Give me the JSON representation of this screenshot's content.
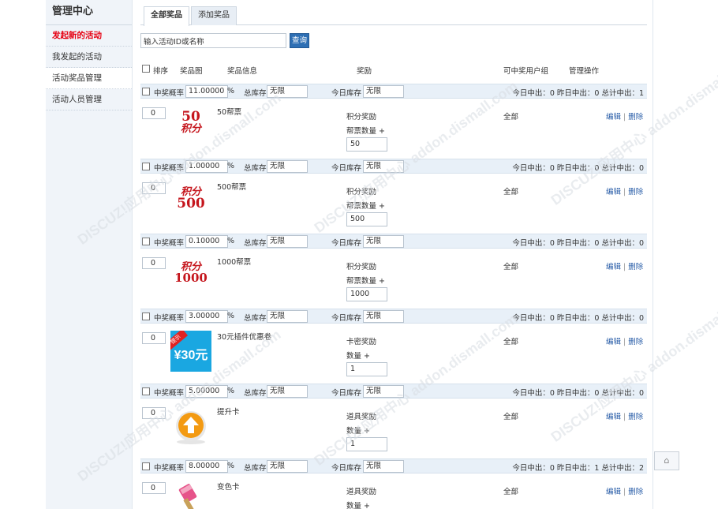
{
  "sidebar": {
    "title": "管理中心",
    "items": [
      {
        "label": "发起新的活动"
      },
      {
        "label": "我发起的活动"
      },
      {
        "label": "活动奖品管理"
      },
      {
        "label": "活动人员管理"
      }
    ]
  },
  "tabs": [
    {
      "label": "全部奖品"
    },
    {
      "label": "添加奖品"
    }
  ],
  "search": {
    "placeholder": "输入活动ID或名称",
    "value": "输入活动ID或名称",
    "button": "查询"
  },
  "table": {
    "headers": {
      "order": "排序",
      "image": "奖品图",
      "info": "奖品信息",
      "reward": "奖励",
      "group": "可中奖用户组",
      "ops": "管理操作"
    },
    "bar_labels": {
      "rate": "中奖概率",
      "percent": "%",
      "total_stock": "总库存",
      "today_stock": "今日库存"
    },
    "rows": [
      {
        "rate": "11.00000",
        "total_stock": "无限",
        "today_stock": "无限",
        "stats": "今日中出：0 昨日中出：0 总计中出：1",
        "order": "0",
        "image": "50-points-image",
        "image_text_top": "50",
        "image_text_bottom": "积分",
        "name": "50帮票",
        "reward_type": "积分奖励",
        "reward_label": "帮票数量 +",
        "reward_value": "50",
        "group": "全部",
        "edit": "编辑",
        "sep": "|",
        "delete": "删除"
      },
      {
        "rate": "1.00000",
        "total_stock": "无限",
        "today_stock": "无限",
        "stats": "今日中出：0 昨日中出：0 总计中出：0",
        "order": "0",
        "image": "500-points-image",
        "image_text_top": "积分",
        "image_text_bottom": "500",
        "name": "500帮票",
        "reward_type": "积分奖励",
        "reward_label": "帮票数量 +",
        "reward_value": "500",
        "group": "全部",
        "edit": "编辑",
        "sep": "|",
        "delete": "删除"
      },
      {
        "rate": "0.10000",
        "total_stock": "无限",
        "today_stock": "无限",
        "stats": "今日中出：0 昨日中出：0 总计中出：0",
        "order": "0",
        "image": "1000-points-image",
        "image_text_top": "积分",
        "image_text_bottom": "1000",
        "name": "1000帮票",
        "reward_type": "积分奖励",
        "reward_label": "帮票数量 +",
        "reward_value": "1000",
        "group": "全部",
        "edit": "编辑",
        "sep": "|",
        "delete": "删除"
      },
      {
        "rate": "3.00000",
        "total_stock": "无限",
        "today_stock": "无限",
        "stats": "今日中出：0 昨日中出：0 总计中出：0",
        "order": "0",
        "image": "coupon-image",
        "image_text_top": "提示",
        "image_text_bottom": "¥30元",
        "name": "30元插件优惠卷",
        "reward_type": "卡密奖励",
        "reward_label": "数量 +",
        "reward_value": "1",
        "group": "全部",
        "edit": "编辑",
        "sep": "|",
        "delete": "删除"
      },
      {
        "rate": "5.00000",
        "total_stock": "无限",
        "today_stock": "无限",
        "stats": "今日中出：0 昨日中出：0 总计中出：0",
        "order": "0",
        "image": "upgrade-card-image",
        "image_text_top": "",
        "image_text_bottom": "",
        "name": "提升卡",
        "reward_type": "道具奖励",
        "reward_label": "数量 +",
        "reward_value": "1",
        "group": "全部",
        "edit": "编辑",
        "sep": "|",
        "delete": "删除"
      },
      {
        "rate": "8.00000",
        "total_stock": "无限",
        "today_stock": "无限",
        "stats": "今日中出：0 昨日中出：1 总计中出：2",
        "order": "0",
        "image": "color-card-image",
        "image_text_top": "",
        "image_text_bottom": "",
        "name": "变色卡",
        "reward_type": "道具奖励",
        "reward_label": "数量 +",
        "reward_value": "",
        "group": "全部",
        "edit": "编辑",
        "sep": "|",
        "delete": "删除"
      }
    ]
  },
  "watermark": {
    "text": "DISCUZ!应用中心 addon.dismall.com"
  },
  "colors": {
    "accent_red": "#e60012",
    "link_blue": "#2a5ea8",
    "row_bar": "#e8f0f8",
    "coupon_blue": "#1aa7e1",
    "button_blue": "#2e6fb4"
  },
  "to_top": {
    "icon": "arrow-up-icon"
  }
}
